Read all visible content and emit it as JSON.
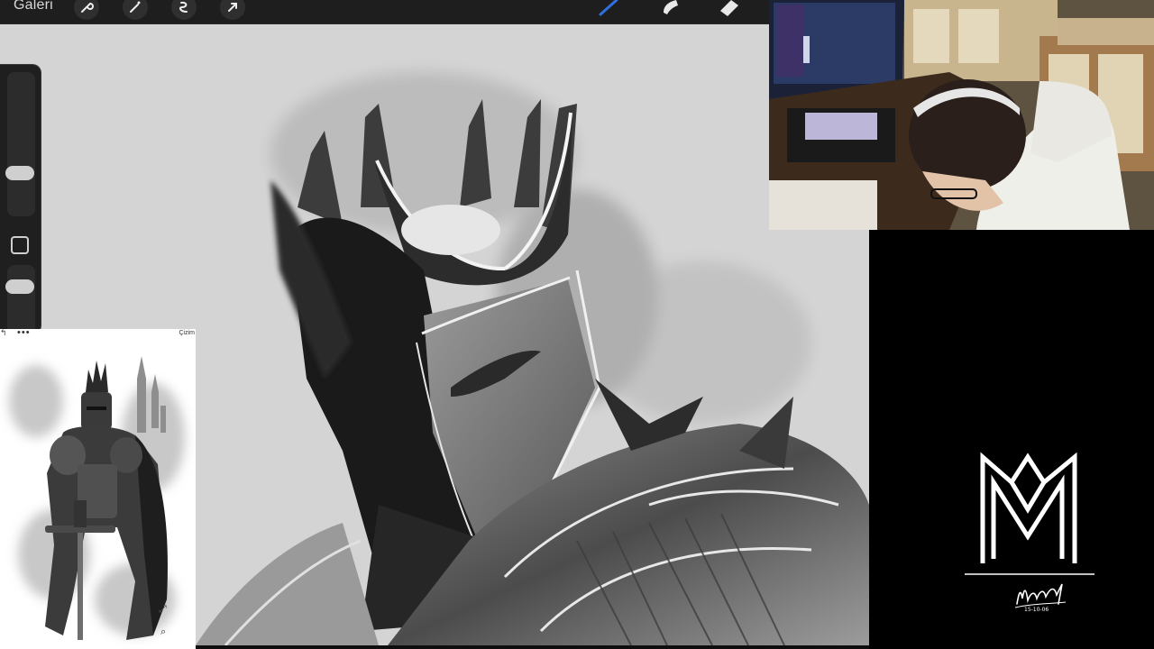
{
  "toolbar": {
    "gallery_label": "Galeri",
    "left_tools": [
      "wrench-icon",
      "magic-wand-icon",
      "selection-icon",
      "transform-arrow-icon"
    ],
    "right_tools": [
      "brush-icon",
      "smudge-icon",
      "eraser-icon"
    ],
    "active_brush_color": "#2f6fe0"
  },
  "sidebar": {
    "brush_size_slider": "brush-size-slider",
    "modify_button": "modify-button",
    "opacity_slider": "opacity-slider"
  },
  "reference": {
    "label": "Çizim",
    "menu_glyph": "•••"
  },
  "logo": {
    "signature_date": "15-10-06"
  },
  "colors": {
    "canvas_bg": "#d4d4d4",
    "toolbar_bg": "#1e1e1e",
    "panel_bg": "#000000"
  }
}
